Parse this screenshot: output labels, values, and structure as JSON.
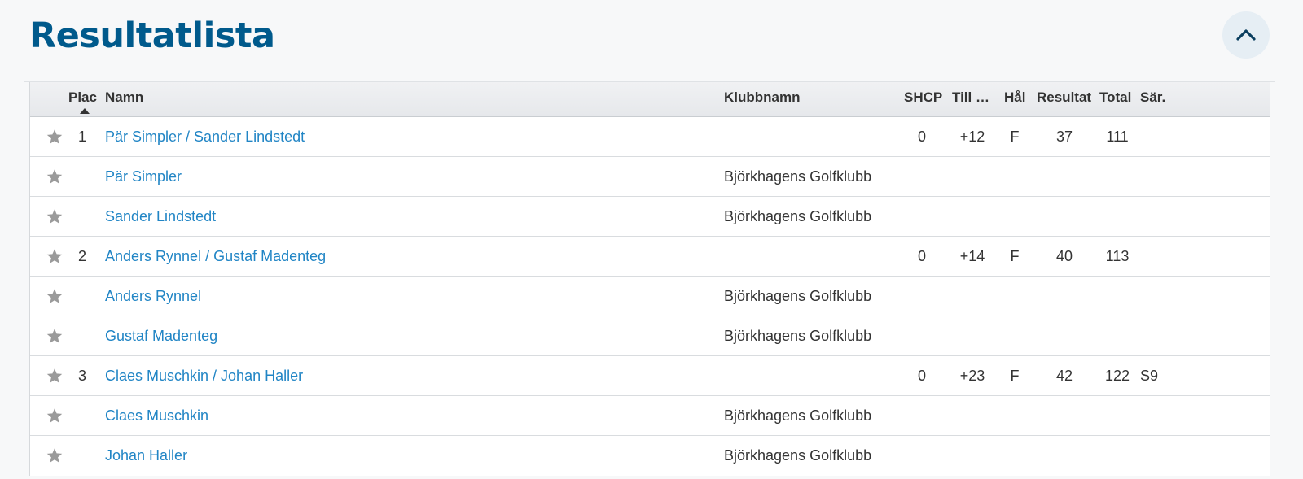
{
  "page": {
    "title": "Resultatlista"
  },
  "header": {
    "plac": "Plac",
    "namn": "Namn",
    "klubb": "Klubbnamn",
    "shcp": "SHCP",
    "till": "Till …",
    "hal": "Hål",
    "resultat": "Resultat",
    "total": "Total",
    "sar": "Sär."
  },
  "icons": {
    "favorite": "star-icon",
    "collapse": "chevron-up-icon"
  },
  "colors": {
    "title": "#005a8c",
    "link": "#2185c5",
    "star": "#9a9a9a"
  },
  "rows": [
    {
      "type": "team",
      "plac": "1",
      "name": "Pär Simpler / Sander Lindstedt",
      "club": "",
      "shcp": "0",
      "till": "+12",
      "hal": "F",
      "resultat": "37",
      "total": "111",
      "sar": ""
    },
    {
      "type": "player",
      "plac": "",
      "name": "Pär Simpler",
      "club": "Björkhagens Golfklubb",
      "shcp": "",
      "till": "",
      "hal": "",
      "resultat": "",
      "total": "",
      "sar": ""
    },
    {
      "type": "player",
      "plac": "",
      "name": "Sander Lindstedt",
      "club": "Björkhagens Golfklubb",
      "shcp": "",
      "till": "",
      "hal": "",
      "resultat": "",
      "total": "",
      "sar": ""
    },
    {
      "type": "team",
      "plac": "2",
      "name": "Anders Rynnel / Gustaf Madenteg",
      "club": "",
      "shcp": "0",
      "till": "+14",
      "hal": "F",
      "resultat": "40",
      "total": "113",
      "sar": ""
    },
    {
      "type": "player",
      "plac": "",
      "name": "Anders Rynnel",
      "club": "Björkhagens Golfklubb",
      "shcp": "",
      "till": "",
      "hal": "",
      "resultat": "",
      "total": "",
      "sar": ""
    },
    {
      "type": "player",
      "plac": "",
      "name": "Gustaf Madenteg",
      "club": "Björkhagens Golfklubb",
      "shcp": "",
      "till": "",
      "hal": "",
      "resultat": "",
      "total": "",
      "sar": ""
    },
    {
      "type": "team",
      "plac": "3",
      "name": "Claes Muschkin / Johan Haller",
      "club": "",
      "shcp": "0",
      "till": "+23",
      "hal": "F",
      "resultat": "42",
      "total": "122",
      "sar": "S9"
    },
    {
      "type": "player",
      "plac": "",
      "name": "Claes Muschkin",
      "club": "Björkhagens Golfklubb",
      "shcp": "",
      "till": "",
      "hal": "",
      "resultat": "",
      "total": "",
      "sar": ""
    },
    {
      "type": "player",
      "plac": "",
      "name": "Johan Haller",
      "club": "Björkhagens Golfklubb",
      "shcp": "",
      "till": "",
      "hal": "",
      "resultat": "",
      "total": "",
      "sar": ""
    }
  ]
}
